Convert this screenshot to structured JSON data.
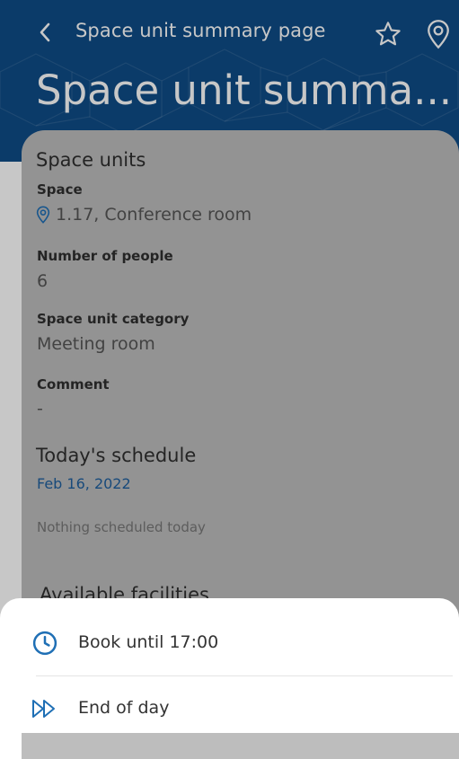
{
  "nav": {
    "title": "Space unit summary page"
  },
  "page_title": "Space unit summa...",
  "space_units": {
    "heading": "Space units",
    "space_label": "Space",
    "space_value": "1.17, Conference room",
    "people_label": "Number of people",
    "people_value": "6",
    "category_label": "Space unit category",
    "category_value": "Meeting room",
    "comment_label": "Comment",
    "comment_value": "-"
  },
  "schedule": {
    "heading": "Today's schedule",
    "date": "Feb 16, 2022",
    "empty_text": "Nothing scheduled today"
  },
  "facilities": {
    "heading": "Available facilities"
  },
  "sheet": {
    "options": [
      {
        "label": "Book until 17:00",
        "icon": "clock-icon"
      },
      {
        "label": "End of day",
        "icon": "fast-forward-icon"
      }
    ]
  },
  "colors": {
    "header": "#0f4c87",
    "accent": "#1f6fb5",
    "card": "#bdbdbd",
    "date": "#1f5f9e"
  }
}
